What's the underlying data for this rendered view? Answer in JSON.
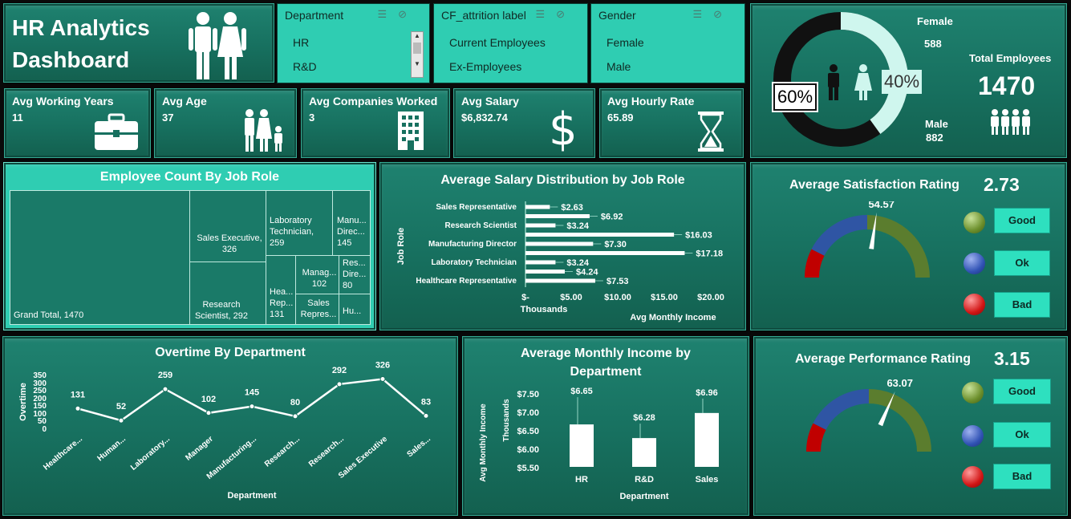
{
  "title": {
    "line1": "HR Analytics",
    "line2": "Dashboard"
  },
  "slicers": [
    {
      "title": "Department",
      "items": [
        "HR",
        "R&D"
      ]
    },
    {
      "title": "CF_attrition label",
      "items": [
        "Current Employees",
        "Ex-Employees"
      ]
    },
    {
      "title": "Gender",
      "items": [
        "Female",
        "Male"
      ]
    }
  ],
  "kpis": [
    {
      "label": "Avg Working Years",
      "value": "11",
      "icon": "briefcase-icon"
    },
    {
      "label": "Avg Age",
      "value": "37",
      "icon": "family-icon"
    },
    {
      "label": "Avg Companies Worked",
      "value": "3",
      "icon": "building-icon"
    },
    {
      "label": "Avg Salary",
      "value": "$6,832.74",
      "icon": "dollar-icon"
    },
    {
      "label": "Avg Hourly Rate",
      "value": "65.89",
      "icon": "hourglass-icon"
    }
  ],
  "gender": {
    "female_label": "Female",
    "female_value": "588",
    "female_pct": "40%",
    "male_label": "Male",
    "male_value": "882",
    "male_pct": "60%",
    "total_label": "Total Employees",
    "total_value": "1470",
    "colors": {
      "male": "#111111",
      "female": "#cff6ee"
    }
  },
  "treemap": {
    "title": "Employee Count By Job Role",
    "cells": [
      {
        "label": "Grand Total, 1470"
      },
      {
        "label": "Sales Executive, 326"
      },
      {
        "label": "Research Scientist, 292"
      },
      {
        "label": "Laboratory Technician, 259"
      },
      {
        "label": "Manu... Direc... 145"
      },
      {
        "label": "Hea... Rep... 131"
      },
      {
        "label": "Manag... 102"
      },
      {
        "label": "Res... Dire... 80"
      },
      {
        "label": "Sales Repres..."
      },
      {
        "label": "Hu..."
      }
    ]
  },
  "salary_chart": {
    "title": "Average Salary Distribution by Job Role",
    "ylabel": "Job Role",
    "xlabel": "Avg Monthly Income",
    "unit_label": "Thousands",
    "x_ticks": [
      "$-",
      "$5.00",
      "$10.00",
      "$15.00",
      "$20.00"
    ],
    "row_labels": [
      "Sales Representative",
      "Research Scientist",
      "Manufacturing Director",
      "Laboratory Technician",
      "Healthcare Representative"
    ]
  },
  "satisfaction": {
    "title": "Average Satisfaction Rating",
    "value": "2.73",
    "gauge_label": "54.57",
    "gauge_fraction": 0.5457
  },
  "performance": {
    "title": "Average Performance Rating",
    "value": "3.15",
    "gauge_label": "63.07",
    "gauge_fraction": 0.6307
  },
  "legend_buttons": [
    "Good",
    "Ok",
    "Bad"
  ],
  "overtime_chart": {
    "title": "Overtime By Department",
    "ylabel": "Overtime",
    "xlabel": "Department",
    "y_ticks": [
      "350",
      "300",
      "250",
      "200",
      "150",
      "100",
      "50",
      "0"
    ],
    "categories": [
      "Healthcare...",
      "Human...",
      "Laboratory...",
      "Manager",
      "Manufacturing...",
      "Research...",
      "Research...",
      "Sales Executive",
      "Sales..."
    ]
  },
  "income_chart": {
    "title_line1": "Average Monthly Income by",
    "title_line2": "Department",
    "ylabel": "Avg Monthly Income",
    "unit_label": "Thousands",
    "xlabel": "Department",
    "y_ticks": [
      "$7.50",
      "$7.00",
      "$6.50",
      "$6.00",
      "$5.50"
    ]
  },
  "chart_data": [
    {
      "type": "bar",
      "orientation": "horizontal",
      "categories": [
        "Sales Representative",
        "",
        "Research Scientist",
        "",
        "Manufacturing Director",
        "",
        "Laboratory Technician",
        "",
        "Healthcare Representative"
      ],
      "values": [
        2.63,
        6.92,
        3.24,
        16.03,
        7.3,
        17.18,
        3.24,
        4.24,
        7.53
      ],
      "data_labels": [
        "$2.63",
        "$6.92",
        "$3.24",
        "$16.03",
        "$7.30",
        "$17.18",
        "$3.24",
        "$4.24",
        "$7.53"
      ],
      "xlim": [
        0,
        20
      ]
    },
    {
      "type": "line",
      "categories": [
        "Healthcare...",
        "Human...",
        "Laboratory...",
        "Manager",
        "Manufacturing...",
        "Research...",
        "Research...",
        "Sales Executive",
        "Sales..."
      ],
      "values": [
        131,
        52,
        259,
        102,
        145,
        80,
        292,
        326,
        83
      ],
      "ylim": [
        0,
        350
      ]
    },
    {
      "type": "bar",
      "categories": [
        "HR",
        "R&D",
        "Sales"
      ],
      "values": [
        6.65,
        6.28,
        6.96
      ],
      "data_labels": [
        "$6.65",
        "$6.28",
        "$6.96"
      ],
      "ylim": [
        5.5,
        7.5
      ]
    }
  ]
}
